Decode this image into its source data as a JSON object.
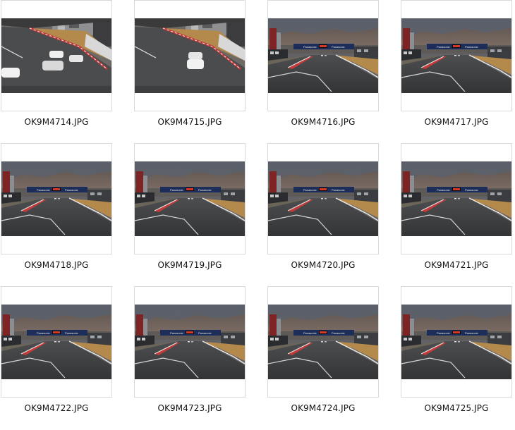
{
  "files": [
    {
      "name": "OK9M4714.JPG",
      "scene": "curve"
    },
    {
      "name": "OK9M4715.JPG",
      "scene": "curve"
    },
    {
      "name": "OK9M4716.JPG",
      "scene": "straight"
    },
    {
      "name": "OK9M4717.JPG",
      "scene": "straight"
    },
    {
      "name": "OK9M4718.JPG",
      "scene": "straight"
    },
    {
      "name": "OK9M4719.JPG",
      "scene": "straight"
    },
    {
      "name": "OK9M4720.JPG",
      "scene": "straight"
    },
    {
      "name": "OK9M4721.JPG",
      "scene": "straight"
    },
    {
      "name": "OK9M4722.JPG",
      "scene": "straight"
    },
    {
      "name": "OK9M4723.JPG",
      "scene": "straight"
    },
    {
      "name": "OK9M4724.JPG",
      "scene": "straight"
    },
    {
      "name": "OK9M4725.JPG",
      "scene": "straight"
    }
  ],
  "banner_text": "Panasonic",
  "colors": {
    "asphalt": "#3d3f41",
    "grass": "#b48a4c",
    "sky": "#4a4d55",
    "kerb_red": "#c23a3a",
    "banner": "#1c2d5a",
    "caption_text": "#111111"
  }
}
